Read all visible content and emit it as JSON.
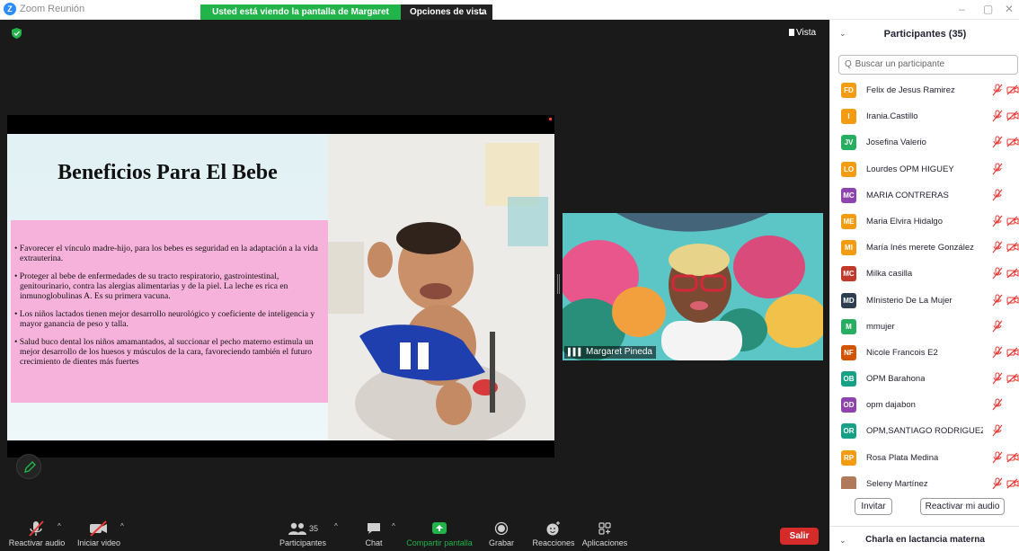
{
  "window": {
    "title": "Zoom Reunión",
    "logo_letter": "Z",
    "minimize": "–",
    "restore": "▢",
    "close": "✕"
  },
  "banner": {
    "viewing_text": "Usted está viendo la pantalla de Margaret Pineda",
    "view_options": "Opciones de vista",
    "chevron": "⌄"
  },
  "meeting": {
    "view_label": "Vista",
    "slide": {
      "title": "Beneficios Para El Bebe",
      "bullets": [
        "• Favorecer el vínculo madre-hijo, para los bebes es seguridad en la adaptación a la vida extrauterina.",
        "• Proteger al bebe de enfermedades de su tracto respiratorio, gastrointestinal, genitourinario, contra las alergias alimentarias y de la piel. La leche es rica en inmunoglobulinas A. Es su primera vacuna.",
        "• Los niños lactados tienen mejor desarrollo neurológico y coeficiente de inteligencia y mayor ganancia de peso y talla.",
        "• Salud buco dental los niños amamantados, al succionar el pecho materno estimula un mejor desarrollo de los huesos y músculos de la cara, favoreciendo también el futuro crecimiento de dientes más fuertes"
      ]
    },
    "speaker_name": "Margaret Pineda",
    "signal_glyph": "▌▌▌"
  },
  "toolbar": {
    "mute_label": "Reactivar audio",
    "video_label": "Iniciar video",
    "participants_label": "Participantes",
    "participants_count": "35",
    "chat_label": "Chat",
    "share_label": "Compartir pantalla",
    "record_label": "Grabar",
    "reactions_label": "Reacciones",
    "apps_label": "Aplicaciones",
    "leave_label": "Salir",
    "caret": "^",
    "colors": {
      "share_green": "#22b34a",
      "leave_red": "#d62b2b"
    }
  },
  "panel": {
    "title": "Participantes (35)",
    "collapse": "⌄",
    "search_icon": "Q",
    "search_placeholder": "Buscar un participante",
    "participants": [
      {
        "initials": "FD",
        "name": "Felix de Jesus Ramirez",
        "color": "#f39c12",
        "video_off": true
      },
      {
        "initials": "I",
        "name": "Irania.Castillo",
        "color": "#f39c12",
        "video_off": true
      },
      {
        "initials": "JV",
        "name": "Josefina Valerio",
        "color": "#27ae60",
        "video_off": true
      },
      {
        "initials": "LO",
        "name": "Lourdes OPM HIGUEY",
        "color": "#f39c12",
        "video_off": false
      },
      {
        "initials": "MC",
        "name": "MARIA CONTRERAS",
        "color": "#8e44ad",
        "video_off": false
      },
      {
        "initials": "ME",
        "name": "Maria Elvira Hidalgo",
        "color": "#f39c12",
        "video_off": true
      },
      {
        "initials": "MI",
        "name": "María Inés merete González",
        "color": "#f39c12",
        "video_off": true
      },
      {
        "initials": "MC",
        "name": "Milka casilla",
        "color": "#c0392b",
        "video_off": true
      },
      {
        "initials": "MD",
        "name": "MInisterio De La Mujer",
        "color": "#2c3e50",
        "video_off": true
      },
      {
        "initials": "M",
        "name": "mmujer",
        "color": "#27ae60",
        "video_off": false
      },
      {
        "initials": "NF",
        "name": "Nicole Francois E2",
        "color": "#d35400",
        "video_off": true
      },
      {
        "initials": "OB",
        "name": "OPM Barahona",
        "color": "#16a085",
        "video_off": true
      },
      {
        "initials": "OD",
        "name": "opm dajabon",
        "color": "#8e44ad",
        "video_off": false
      },
      {
        "initials": "OR",
        "name": "OPM,SANTIAGO RODRIGUEZ",
        "color": "#16a085",
        "video_off": false
      },
      {
        "initials": "RP",
        "name": "Rosa Plata Medina",
        "color": "#f39c12",
        "video_off": true
      },
      {
        "initials": "",
        "name": "Seleny Martínez",
        "color": "#b07a5a",
        "video_off": true
      }
    ],
    "invite_label": "Invitar",
    "unmute_me_label": "Reactivar mi audio",
    "chat_title": "Charla en lactancia materna"
  }
}
